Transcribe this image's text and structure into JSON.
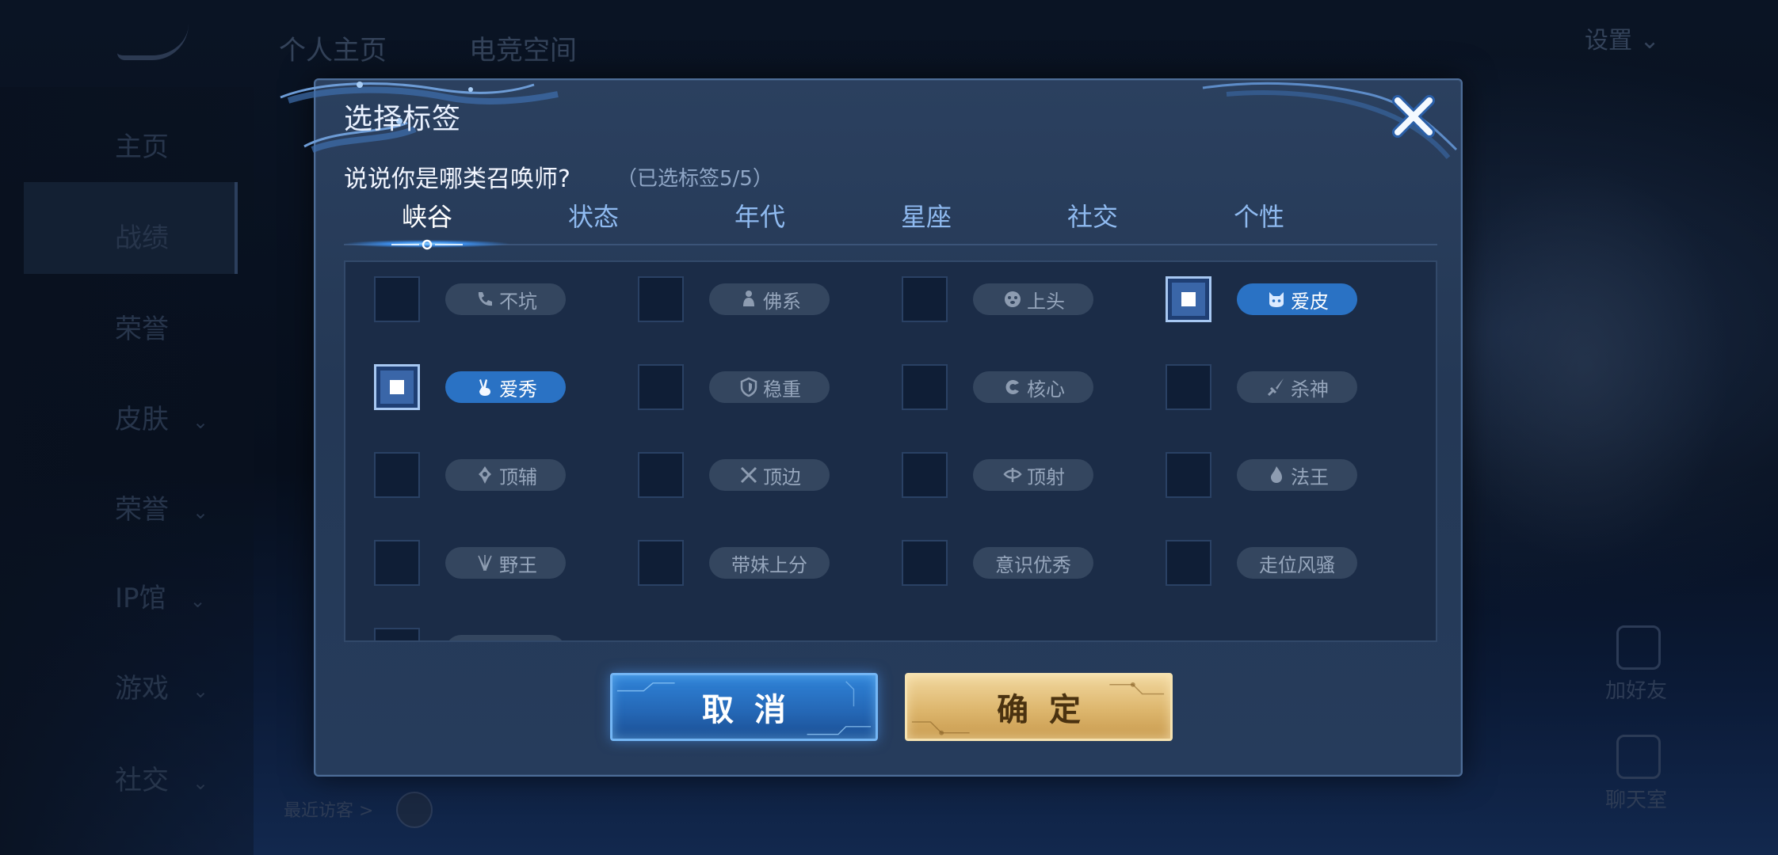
{
  "background": {
    "top_nav": [
      "个人主页",
      "电竞空间"
    ],
    "settings_label": "设置",
    "sidebar": [
      {
        "label": "主页",
        "chevron": ""
      },
      {
        "label": "战绩",
        "chevron": ""
      },
      {
        "label": "荣誉",
        "chevron": ""
      },
      {
        "label": "皮肤",
        "chevron": "⌄"
      },
      {
        "label": "荣誉",
        "chevron": "⌄"
      },
      {
        "label": "IP馆",
        "chevron": "⌄"
      },
      {
        "label": "游戏",
        "chevron": "⌄"
      },
      {
        "label": "社交",
        "chevron": "⌄"
      }
    ],
    "bottom_text": "最近访客 >",
    "right_icons": [
      "加好友",
      "聊天室"
    ]
  },
  "dialog": {
    "title": "选择标签",
    "prompt": "说说你是哪类召唤师?",
    "counter": "（已选标签5/5）",
    "tabs": [
      "峡谷",
      "状态",
      "年代",
      "星座",
      "社交",
      "个性"
    ],
    "active_tab": "峡谷",
    "tags": [
      {
        "label": "不坑",
        "icon": "phone-icon",
        "checked": false
      },
      {
        "label": "佛系",
        "icon": "buddha-icon",
        "checked": false
      },
      {
        "label": "上头",
        "icon": "dizzy-face-icon",
        "checked": false
      },
      {
        "label": "爱皮",
        "icon": "cat-face-icon",
        "checked": true
      },
      {
        "label": "爱秀",
        "icon": "victory-hand-icon",
        "checked": true
      },
      {
        "label": "稳重",
        "icon": "shield-icon",
        "checked": false
      },
      {
        "label": "核心",
        "icon": "c-letter-icon",
        "checked": false
      },
      {
        "label": "杀神",
        "icon": "blade-icon",
        "checked": false
      },
      {
        "label": "顶辅",
        "icon": "support-icon",
        "checked": false
      },
      {
        "label": "顶边",
        "icon": "crossed-swords-icon",
        "checked": false
      },
      {
        "label": "顶射",
        "icon": "archer-icon",
        "checked": false
      },
      {
        "label": "法王",
        "icon": "mage-flame-icon",
        "checked": false
      },
      {
        "label": "野王",
        "icon": "jungle-claw-icon",
        "checked": false
      },
      {
        "label": "带妹上分",
        "icon": "",
        "checked": false
      },
      {
        "label": "意识优秀",
        "icon": "",
        "checked": false
      },
      {
        "label": "走位风骚",
        "icon": "",
        "checked": false
      },
      {
        "label": "",
        "icon": "",
        "checked": false
      }
    ],
    "cancel_label": "取消",
    "confirm_label": "确定",
    "colors": {
      "accent_blue": "#2a72c4",
      "confirm_gold": "#ddb66d",
      "panel": "#243855"
    }
  }
}
